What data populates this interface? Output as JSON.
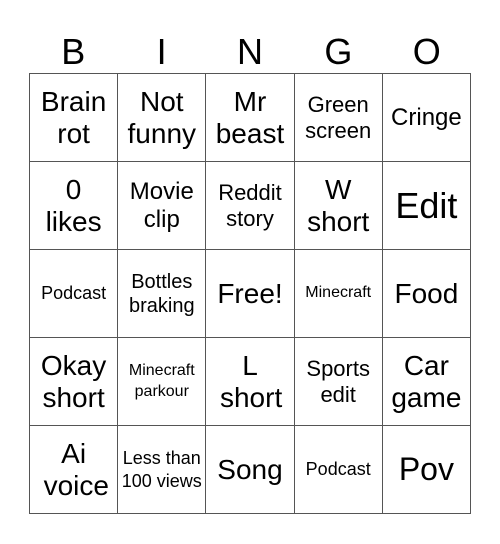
{
  "header": {
    "letters": [
      "B",
      "I",
      "N",
      "G",
      "O"
    ]
  },
  "cells": [
    [
      "Brain rot",
      "Not funny",
      "Mr beast",
      "Green screen",
      "Cringe"
    ],
    [
      "0 likes",
      "Movie clip",
      "Reddit story",
      "W short",
      "Edit"
    ],
    [
      "Podcast",
      "Bottles braking",
      "Free!",
      "Minecraft",
      "Food"
    ],
    [
      "Okay short",
      "Minecraft parkour",
      "L short",
      "Sports edit",
      "Car game"
    ],
    [
      "Ai voice",
      "Less than 100 views",
      "Song",
      "Podcast",
      "Pov"
    ]
  ]
}
